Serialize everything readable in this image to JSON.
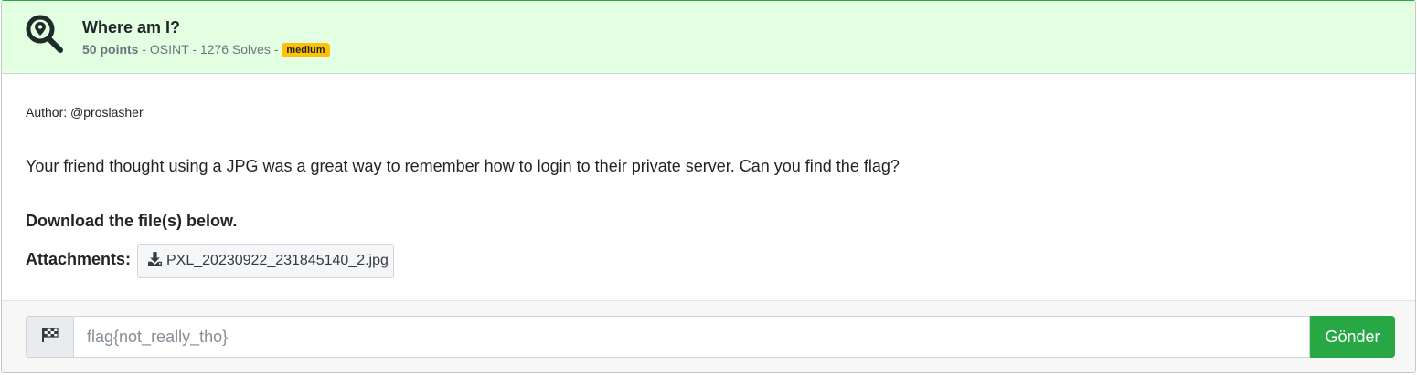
{
  "challenge": {
    "title": "Where am I?",
    "points": "50 points",
    "meta_rest": " - OSINT - 1276 Solves - ",
    "difficulty": "medium",
    "author": "Author: @proslasher",
    "description": "Your friend thought using a JPG was a great way to remember how to login to their private server. Can you find the flag?",
    "download_text": "Download the file(s) below.",
    "attachments_label": "Attachments:",
    "attachments": [
      "PXL_20230922_231845140_2.jpg"
    ]
  },
  "flag_form": {
    "placeholder": "flag{not_really_tho}",
    "submit_label": "Gönder"
  },
  "icons": {
    "header": "map-search-icon",
    "download": "download-icon",
    "flag": "checkered-flag-icon"
  },
  "colors": {
    "header_bg": "#e2ffe2",
    "badge": "#ffc107",
    "submit": "#28a745"
  }
}
